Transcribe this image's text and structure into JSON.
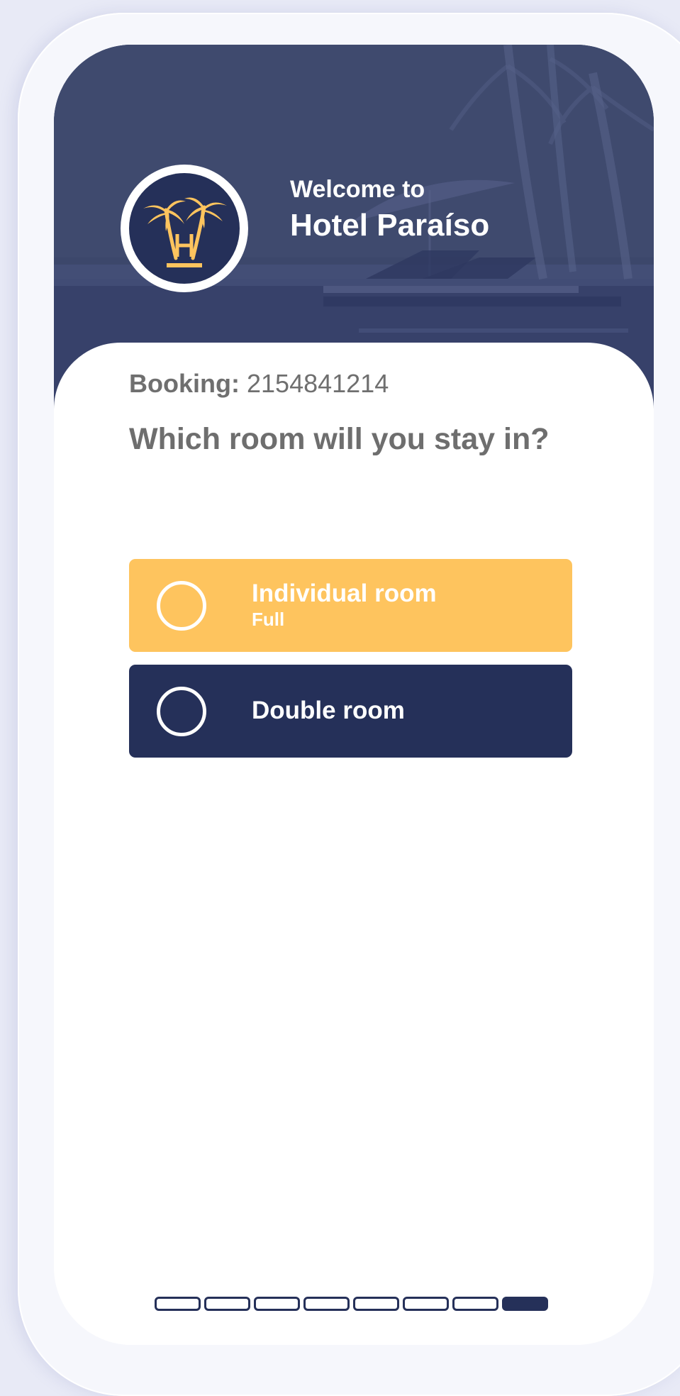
{
  "header": {
    "welcome": "Welcome to",
    "hotel_name": "Hotel Paraíso",
    "logo_icon": "palm-trees-hotel-logo-icon",
    "logo_letter": "H"
  },
  "booking": {
    "label": "Booking:",
    "number": "2154841214"
  },
  "question": "Which room will you stay in?",
  "options": [
    {
      "title": "Individual room",
      "subtitle": "Full",
      "selected": false,
      "color": "#fec45e"
    },
    {
      "title": "Double room",
      "subtitle": "",
      "selected": false,
      "color": "#253059"
    }
  ],
  "progress": {
    "total_steps": 8,
    "current_step": 8
  },
  "colors": {
    "navy": "#253059",
    "hero": "#3b4669",
    "amber": "#fec45e",
    "text_gray": "#6e6e6e"
  }
}
